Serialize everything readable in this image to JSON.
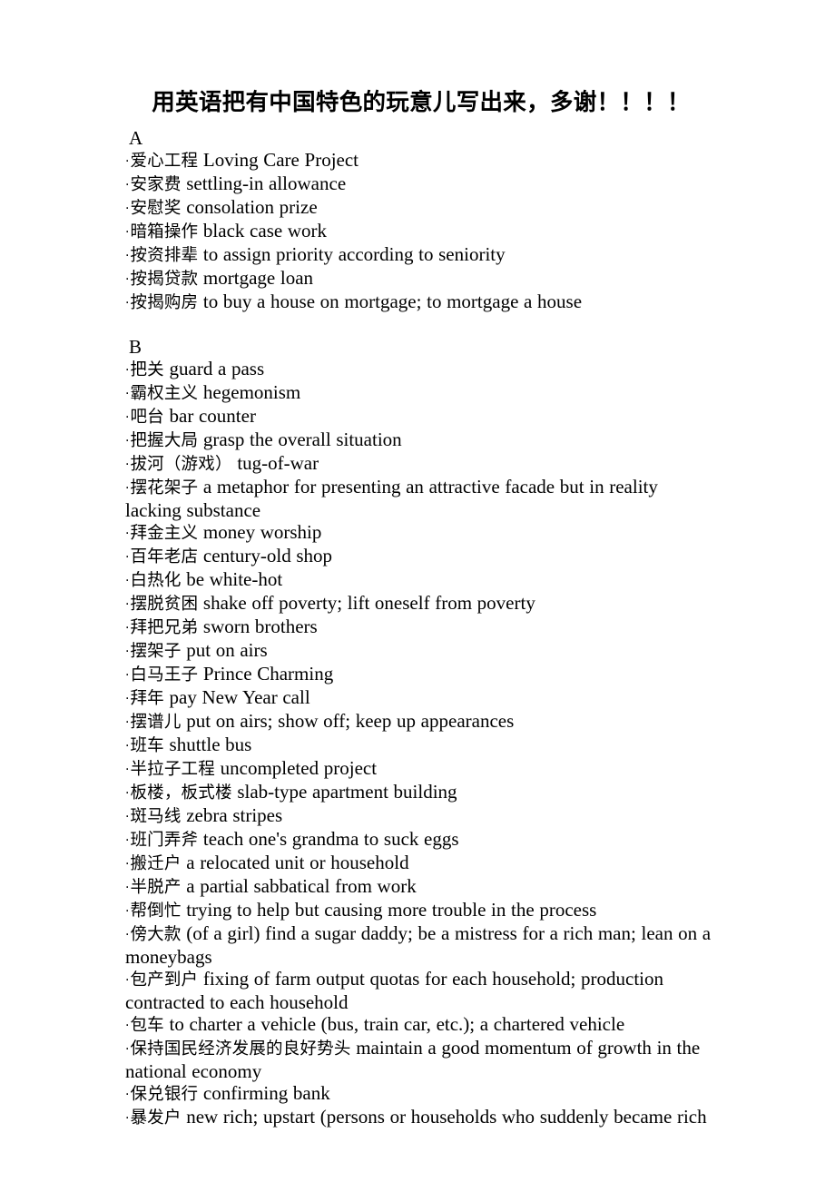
{
  "document": {
    "title": "用英语把有中国特色的玩意儿写出来，多谢！！！！",
    "bullet_glyph": "·"
  },
  "sections": [
    {
      "letter": "A",
      "entries": [
        {
          "term": "爱心工程",
          "gloss": "Loving Care Project"
        },
        {
          "term": "安家费",
          "gloss": "settling-in allowance"
        },
        {
          "term": "安慰奖",
          "gloss": "consolation prize"
        },
        {
          "term": "暗箱操作",
          "gloss": "black case work"
        },
        {
          "term": "按资排辈",
          "gloss": "to assign priority according to seniority"
        },
        {
          "term": "按揭贷款",
          "gloss": "mortgage loan"
        },
        {
          "term": "按揭购房",
          "gloss": "to buy a house on mortgage; to mortgage a house"
        }
      ]
    },
    {
      "letter": "B",
      "entries": [
        {
          "term": "把关",
          "gloss": "guard a pass"
        },
        {
          "term": "霸权主义",
          "gloss": "hegemonism"
        },
        {
          "term": "吧台",
          "gloss": "bar counter"
        },
        {
          "term": "把握大局",
          "gloss": "grasp the overall situation"
        },
        {
          "term": "拔河（游戏）",
          "gloss": "tug-of-war"
        },
        {
          "term": "摆花架子",
          "gloss": "a metaphor for presenting an attractive facade but in reality lacking substance"
        },
        {
          "term": "拜金主义",
          "gloss": "money worship"
        },
        {
          "term": "百年老店",
          "gloss": "century-old shop"
        },
        {
          "term": "白热化",
          "gloss": "be white-hot"
        },
        {
          "term": "摆脱贫困",
          "gloss": "shake off poverty; lift oneself from poverty"
        },
        {
          "term": "拜把兄弟",
          "gloss": "sworn brothers"
        },
        {
          "term": "摆架子",
          "gloss": "put on airs"
        },
        {
          "term": "白马王子",
          "gloss": "Prince Charming"
        },
        {
          "term": "拜年",
          "gloss": "pay New Year call"
        },
        {
          "term": "摆谱儿",
          "gloss": "put on airs; show off; keep up appearances"
        },
        {
          "term": "班车",
          "gloss": "shuttle bus"
        },
        {
          "term": "半拉子工程",
          "gloss": "uncompleted project"
        },
        {
          "term": "板楼，板式楼",
          "gloss": "slab-type apartment building"
        },
        {
          "term": "斑马线",
          "gloss": "zebra stripes"
        },
        {
          "term": "班门弄斧",
          "gloss": "teach one's grandma to suck eggs"
        },
        {
          "term": "搬迁户",
          "gloss": "a relocated unit or household"
        },
        {
          "term": "半脱产",
          "gloss": "a partial sabbatical from work"
        },
        {
          "term": "帮倒忙",
          "gloss": "trying to help but causing more trouble in the process"
        },
        {
          "term": "傍大款",
          "gloss": "(of a girl) find a sugar daddy; be a mistress for a rich man; lean on a moneybags"
        },
        {
          "term": "包产到户",
          "gloss": "fixing of farm output quotas for each household; production contracted to each household"
        },
        {
          "term": "包车",
          "gloss": "to charter a vehicle (bus, train car, etc.); a chartered vehicle"
        },
        {
          "term": "保持国民经济发展的良好势头",
          "gloss": "maintain a good momentum of growth in the national economy"
        },
        {
          "term": "保兑银行",
          "gloss": "confirming bank"
        },
        {
          "term": "暴发户",
          "gloss": "new rich; upstart (persons or households who suddenly became rich"
        }
      ]
    }
  ]
}
